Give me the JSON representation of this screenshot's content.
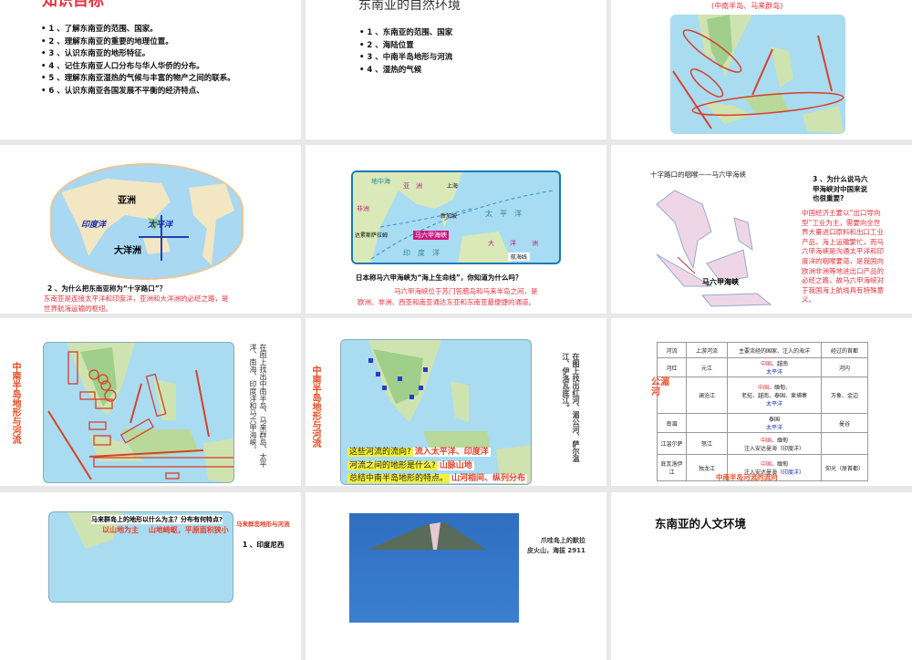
{
  "slides": [
    {
      "title": "知识目标",
      "bullets": [
        "• 1 、了解东南亚的范围、国家。",
        "• 2 、理解东南亚的重要的地理位置。",
        "• 3 、认识东南亚的地形特征。",
        "• 4 、记住东南亚人口分布与华人华侨的分布。",
        "• 5 、理解东南亚湿热的气候与丰富的物产之间的联系。",
        "• 6 、认识东南亚各国发展不平衡的经济特点、"
      ]
    },
    {
      "title": "东南亚的自然环境",
      "bullets": [
        "• 1 、东南亚的范围、国家",
        "• 2 、海陆位置",
        "• 3 、中南半岛地形与河流",
        "• 4 、湿热的气候"
      ]
    },
    {
      "subtitle": "(中南半岛、马来群岛)"
    },
    {
      "map_labels": [
        "亚洲",
        "印度洋",
        "太平洋",
        "大洋洲"
      ],
      "question": "2 、为什么把东南亚称为“十字路口”？",
      "answer_lines": [
        "东南亚是连接太平洋和印度洋，亚洲和大洋洲的必经之路，是",
        "世界航海运输的枢纽。"
      ]
    },
    {
      "map_labels": [
        "地中海",
        "亚　洲",
        "上海",
        "非洲",
        "新加坡",
        "达累斯萨拉姆",
        "马六甲海峡",
        "太　平　洋",
        "印　度　洋",
        "大",
        "洋",
        "洲",
        "航海线"
      ],
      "question": "日本称马六甲海峡为“海上生命线”，你知道为什么吗？",
      "answer_lines": [
        "马六甲海峡位于苏门答腊岛和马来半岛之间，是",
        "欧洲、非洲、西亚和南亚通达东亚和东南亚最便捷的通道。"
      ]
    },
    {
      "title": "十字路口的咽喉——马六甲海峡",
      "strait_label": "马六甲海峡",
      "question_lines": [
        "3 、为什么说马六",
        "甲海峡对中国来说",
        "也很重要?"
      ],
      "answer_lines": [
        "中国经济主要以“出口导向",
        "型”工业为主，需要向全世",
        "界大量进口原料和出口工业",
        "产品，海上运输繁忙，而马",
        "六甲海峡是沟通太平洋和印",
        "度洋的咽喉要道，是我国向",
        "欧洲非洲等地进出口产品的",
        "必经之路，故马六甲海峡对",
        "于我国海上航线具有特殊意",
        "义。"
      ]
    },
    {
      "side_title": "中南半岛地形与河流",
      "instruction": "在图上找出中南半岛、马来群岛、太平洋、南海、印度洋和马六甲海峡。"
    },
    {
      "side_title": "中南半岛地形与河流",
      "instruction": "在图上找出红河、湄公河、萨尔温江、伊洛瓦底江。",
      "qa": [
        {
          "q": "这些河流的流向?",
          "a": "流入太平洋、印度洋"
        },
        {
          "q": "河流之间的地形是什么?",
          "a": "山脉山地"
        },
        {
          "q": "总结中南半岛地形的特点。",
          "a": "山河相间、纵列分布"
        }
      ]
    },
    {
      "table": {
        "headers": [
          "河流",
          "上游河流",
          "主要流经的国家、注入的海洋",
          "经过的首都"
        ],
        "rows": [
          {
            "river": "河红",
            "upstream": "元江",
            "countries_red": "中国",
            "countries": "、越南",
            "ocean": "太平洋",
            "capital": "河内"
          },
          {
            "river": "",
            "upstream": "澜沧江",
            "countries_red": "中国",
            "countries": "、缅甸、",
            "countries2": "老挝、越南、泰国、柬埔寨",
            "ocean": "太平洋",
            "capital": "万象、金边"
          },
          {
            "river": "南湄",
            "upstream": "",
            "countries_red": "",
            "countries": "泰国",
            "ocean": "太平洋",
            "capital": "曼谷"
          },
          {
            "river": "江温尔萨",
            "upstream": "怒江",
            "countries_red": "中国",
            "countries": "、缅甸",
            "ocean_black": "注入安达曼海（印度洋）",
            "capital": ""
          },
          {
            "river": "底瓦洛伊江",
            "upstream": "独龙江",
            "countries_red": "中国",
            "countries": "、缅甸",
            "ocean_black": "注入安达曼海（",
            "ocean": "印度洋",
            "ocean_end": "）",
            "capital": "仰光（原首都）"
          }
        ]
      },
      "side_label": "公湄河",
      "caption": "中南半岛河流的流向"
    },
    {
      "question": "马来群岛上的地形以什么为主？分布有何特点?",
      "answer": "以山地为主　 山地崎岖，平原面积狭小",
      "side_label": "马来群岛地形与河流",
      "item": "1 、印度尼西"
    },
    {
      "caption_lines": [
        "爪哇岛上的默拉",
        "皮火山，海拔 2911"
      ]
    },
    {
      "title": "东南亚的人文环境"
    }
  ],
  "colors": {
    "accent_red": "#e8303a",
    "highlight": "#f5f03a",
    "ocean_blue": "#1a2fb0"
  }
}
